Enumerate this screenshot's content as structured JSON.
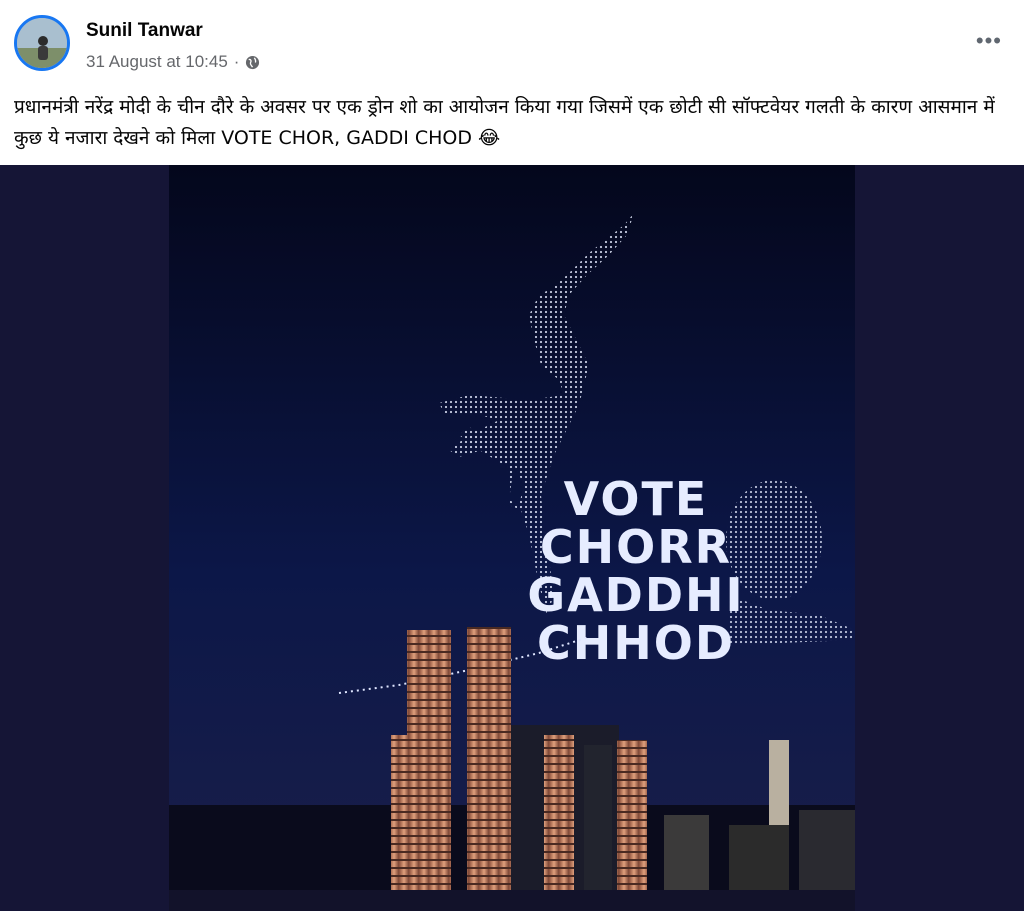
{
  "post": {
    "author": "Sunil Tanwar",
    "timestamp": "31 August at 10:45",
    "separator": "·",
    "privacy_icon": "globe-icon",
    "more_icon": "more-horizontal-icon",
    "caption": "प्रधानमंत्री नरेंद्र मोदी के चीन दौरे के अवसर पर एक ड्रोन शो का आयोजन किया गया जिसमें एक छोटी सी सॉफ्टवेयर गलती के कारण आसमान में कुछ ये नजारा देखने को मिला VOTE CHOR, GADDI CHOD 😂"
  },
  "image": {
    "overlay_lines": [
      "VOTE",
      "CHORR",
      "GADDHI",
      "CHHOD"
    ]
  },
  "colors": {
    "accent": "#1877f2",
    "sky": "#0b1240",
    "drone": "#dfe6ff",
    "tower": "#c9876a"
  }
}
